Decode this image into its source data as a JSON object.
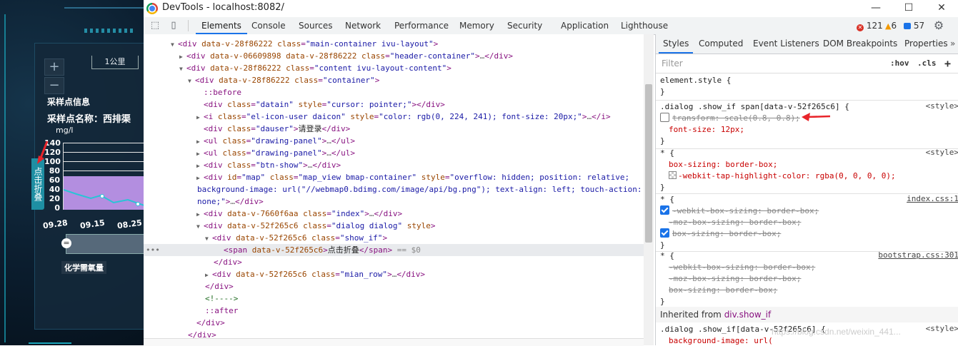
{
  "app": {
    "zoom_in": "+",
    "zoom_out": "−",
    "scale_label": "1公里",
    "section_title": "采样点信息",
    "sample_name": "采样点名称：西排渠",
    "unit": "mg/l",
    "y_ticks": [
      "140",
      "120",
      "100",
      "80",
      "60",
      "40",
      "20",
      "0"
    ],
    "x_ticks": [
      "09.28",
      "09.15",
      "08.25"
    ],
    "indicator": "化学需氧量",
    "fold_button": "点击折叠",
    "slider_handle": "="
  },
  "window": {
    "title": "DevTools - localhost:8082/",
    "minimize": "—",
    "maximize": "☐",
    "close": "✕"
  },
  "toolbar": {
    "tabs": [
      "Elements",
      "Console",
      "Sources",
      "Network",
      "Performance",
      "Memory",
      "Security",
      "Application",
      "Lighthouse"
    ],
    "active_tab": "Elements",
    "errors": "121",
    "warnings": "6",
    "info": "57"
  },
  "elements": {
    "lines": [
      {
        "t": "<div data-v-28f86222 class=\"main-container ivu-layout\">"
      },
      {
        "t": "<div data-v-06609898 data-v-28f86222 class=\"header-container\">…</div>"
      },
      {
        "t": "<div data-v-28f86222 class=\"content ivu-layout-content\">"
      },
      {
        "t": "<div data-v-28f86222 class=\"container\">"
      },
      {
        "t": "::before"
      },
      {
        "t": "<div class=\"datain\" style=\"cursor: pointer;\"></div>"
      },
      {
        "t": "<i class=\"el-icon-user daicon\" style=\"color: rgb(0, 224, 241); font-size: 20px;\">…</i>"
      },
      {
        "t": "<div class=\"dauser\">请登录</div>"
      },
      {
        "t": "<ul class=\"drawing-panel\">…</ul>"
      },
      {
        "t": "<ul class=\"drawing-panel\">…</ul>"
      },
      {
        "t": "<div class=\"btn-show\">…</div>"
      },
      {
        "t": "<div id=\"map\" class=\"map_view bmap-container\" style=\"overflow: hidden; position: relative;"
      },
      {
        "t": "background-image: url(\"//webmap0.bdimg.com/image/api/bg.png\"); text-align: left; touch-action:"
      },
      {
        "t": "none;\">…</div>"
      },
      {
        "t": "<div data-v-7660f6aa class=\"index\">…</div>"
      },
      {
        "t": "<div data-v-52f265c6 class=\"dialog dialog\" style>"
      },
      {
        "t": "<div data-v-52f265c6 class=\"show_if\">"
      },
      {
        "t": "<span data-v-52f265c6>点击折叠</span> == $0"
      },
      {
        "t": "</div>"
      },
      {
        "t": "<div data-v-52f265c6 class=\"mian_row\">…</div>"
      },
      {
        "t": "</div>"
      },
      {
        "t": "<!---->"
      },
      {
        "t": "::after"
      },
      {
        "t": "</div>"
      },
      {
        "t": "</div>"
      }
    ]
  },
  "styles": {
    "tabs": [
      "Styles",
      "Computed",
      "Event Listeners",
      "DOM Breakpoints",
      "Properties"
    ],
    "active_tab": "Styles",
    "filter_placeholder": "Filter",
    "hov": ":hov",
    "cls": ".cls",
    "add": "+",
    "rules": {
      "element_style": "element.style {",
      "close": "}",
      "r1_selector": ".dialog .show_if span[data-v-52f265c6] {",
      "r1_source": "<style>",
      "r1_p1": "transform: scale(0.8, 0.8);",
      "r1_p2": "font-size: 12px;",
      "r2_selector": "* {",
      "r2_source": "<style>",
      "r2_p1": "box-sizing: border-box;",
      "r2_p2": "-webkit-tap-highlight-color: rgba(0, 0, 0, 0);",
      "r3_selector": "* {",
      "r3_source": "index.css:1",
      "r3_p1": "-webkit-box-sizing: border-box;",
      "r3_p2": "-moz-box-sizing: border-box;",
      "r3_p3": "box-sizing: border-box;",
      "r4_selector": "* {",
      "r4_source": "bootstrap.css:301",
      "r4_p1": "-webkit-box-sizing: border-box;",
      "r4_p2": "-moz-box-sizing: border-box;",
      "r4_p3": "box-sizing: border-box;",
      "inherited_label": "Inherited from",
      "inherited_link": "div.show_if",
      "r5_selector": ".dialog .show_if[data-v-52f265c6] {",
      "r5_source": "<style>",
      "r5_p1": "background-image: url("
    }
  },
  "watermark": "https://blog.csdn.net/weixin_441...",
  "colors": {
    "accent": "#1a73e8",
    "app_bg": "#0b1d2e",
    "chart_fill": "#b38ee0",
    "chart_line": "#29c4d6",
    "annotation": "#e8242a"
  }
}
